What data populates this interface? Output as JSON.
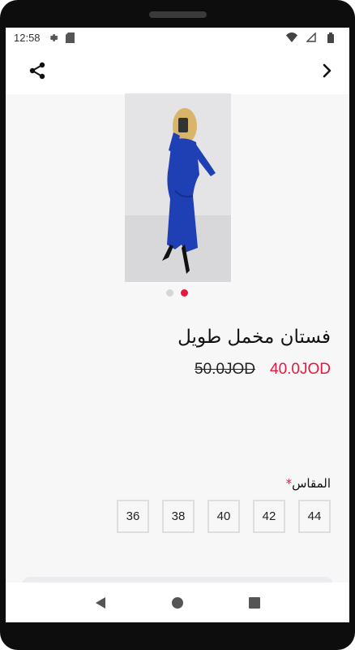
{
  "status_bar": {
    "time": "12:58",
    "left_icons": [
      "settings-icon",
      "sd-card-icon"
    ],
    "right_icons": [
      "wifi-icon",
      "signal-icon",
      "battery-icon"
    ]
  },
  "app_bar": {
    "share_icon": "share-icon",
    "forward_icon": "chevron-right-icon"
  },
  "product": {
    "image_alt": "blue velvet long dress",
    "carousel": {
      "count": 2,
      "active_index": 1
    },
    "title": "فستان مخمل طويل",
    "old_price": "50.0JOD",
    "new_price": "40.0JOD"
  },
  "sizes": {
    "label": "المقاس",
    "required_mark": "*",
    "options": [
      "44",
      "42",
      "40",
      "38",
      "36"
    ]
  },
  "nav_bar": {
    "back_icon": "back-triangle-icon",
    "home_icon": "home-circle-icon",
    "recents_icon": "recents-square-icon"
  },
  "colors": {
    "accent": "#e8173f",
    "background": "#f7f7f7",
    "dress": "#1f3fb5",
    "dot_inactive": "#d6d6d8"
  }
}
